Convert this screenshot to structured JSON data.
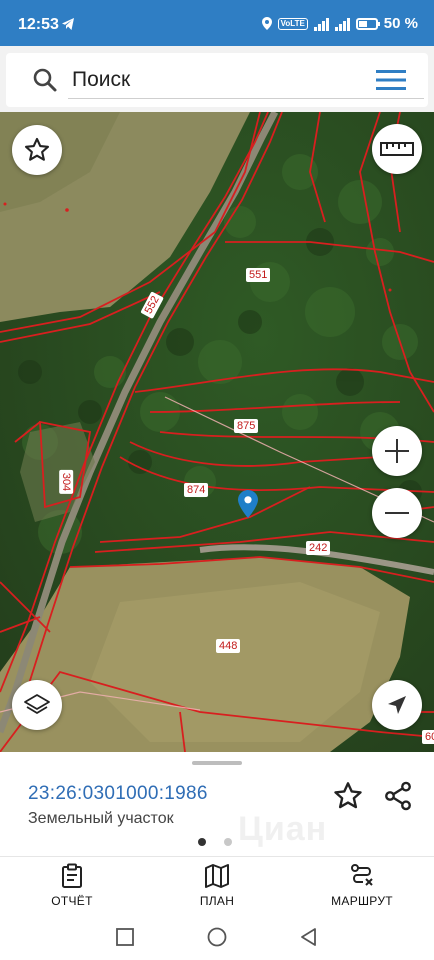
{
  "status": {
    "time": "12:53",
    "network": "VoLTE",
    "battery": "50 %"
  },
  "search": {
    "placeholder": "Поиск"
  },
  "map": {
    "parcels": [
      "551",
      "552",
      "875",
      "874",
      "304",
      "242",
      "448",
      "60"
    ],
    "boundary_color": "#d81f1f"
  },
  "sheet": {
    "cadastral_number": "23:26:0301000:1986",
    "type_label": "Земельный участок",
    "watermark": "Циан"
  },
  "nav": {
    "report": "ОТЧЁТ",
    "plan": "ПЛАН",
    "route": "МАРШРУТ"
  },
  "colors": {
    "accent": "#2f7ec4",
    "link": "#2f6db5",
    "pin": "#1f7fc8"
  }
}
